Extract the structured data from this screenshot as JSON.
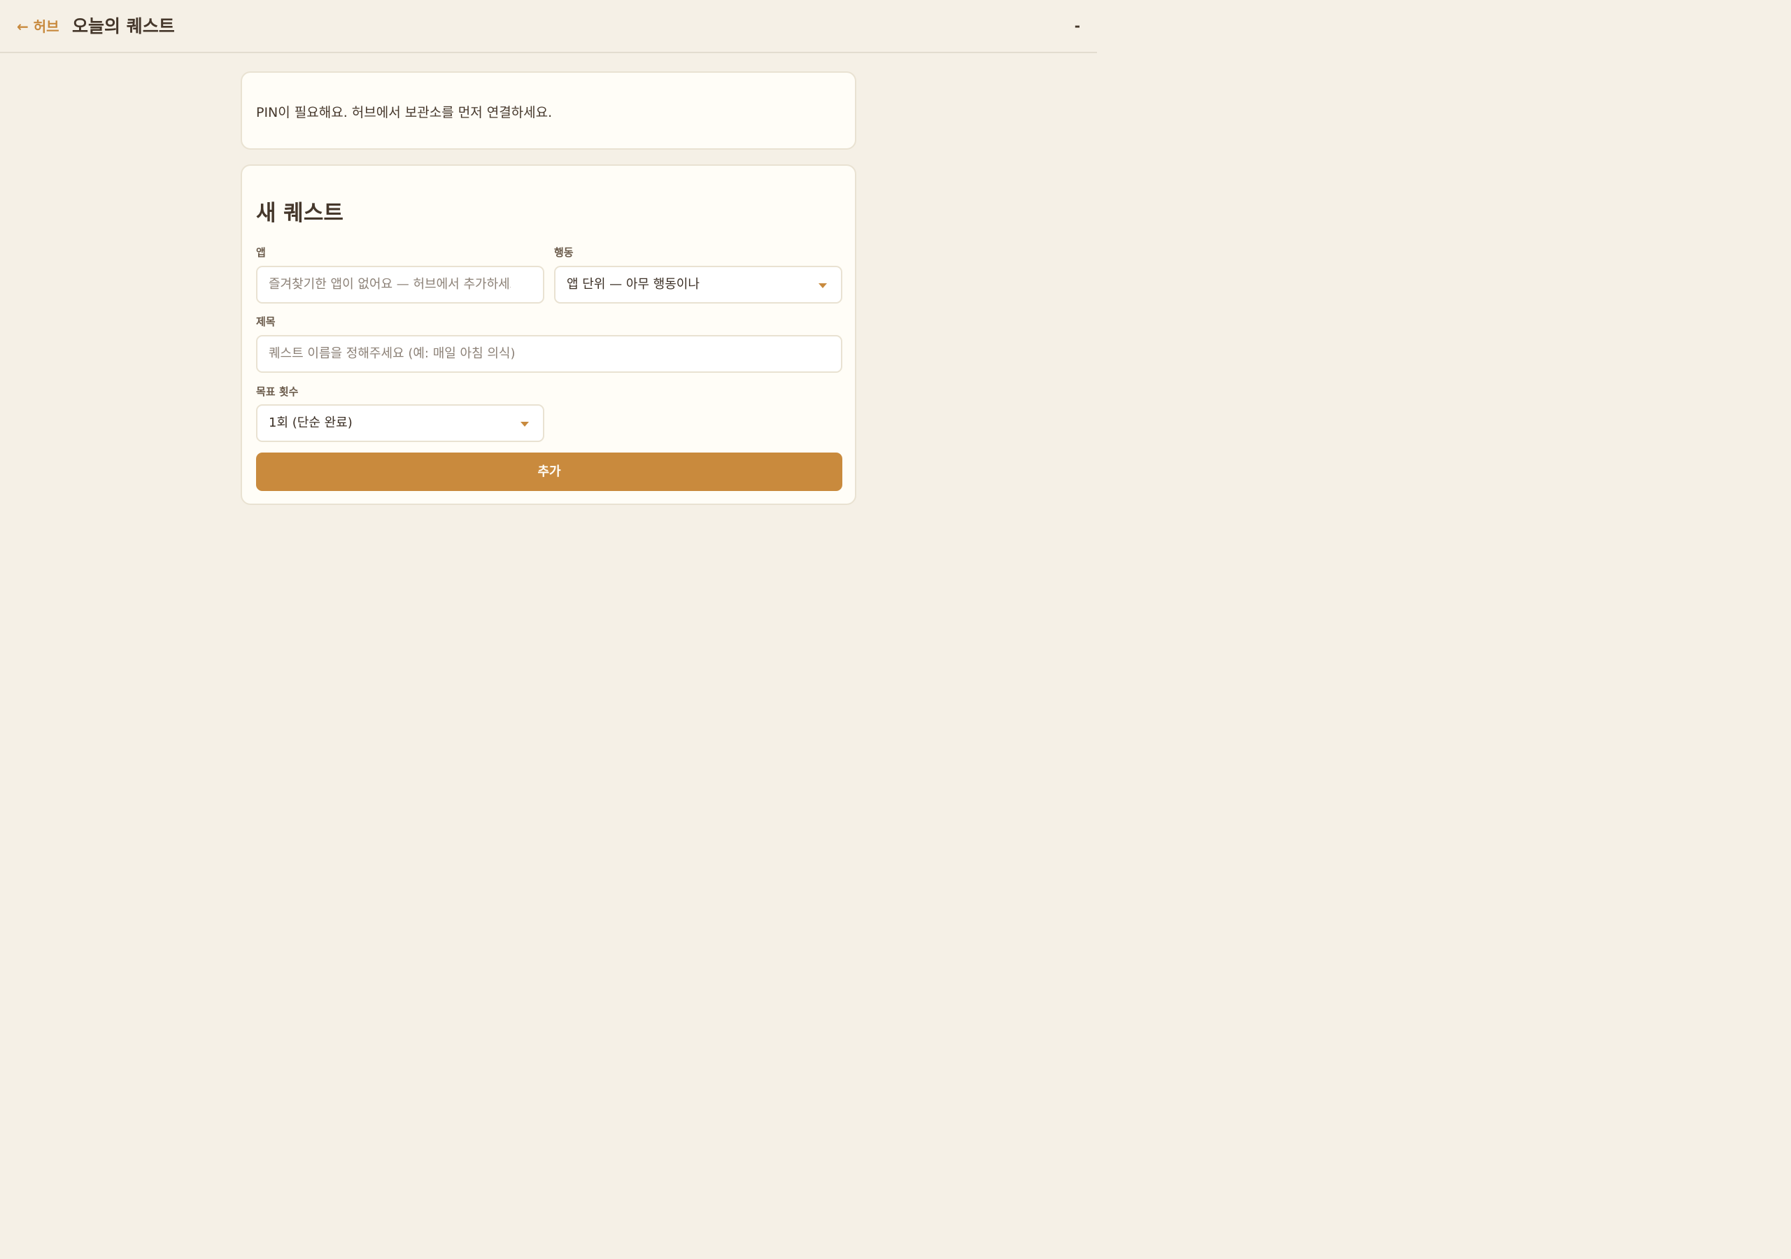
{
  "header": {
    "back_label": "← 허브",
    "title": "오늘의 퀘스트",
    "right_indicator": "-"
  },
  "notice": {
    "text": "PIN이 필요해요. 허브에서 보관소를 먼저 연결하세요."
  },
  "form": {
    "title": "새 퀘스트",
    "app": {
      "label": "앱",
      "placeholder": "즐겨찾기한 앱이 없어요 — 허브에서 추가하세요"
    },
    "action": {
      "label": "행동",
      "selected": "앱 단위 — 아무 행동이나"
    },
    "name": {
      "label": "제목",
      "placeholder": "퀘스트 이름을 정해주세요 (예: 매일 아침 의식)"
    },
    "target_count": {
      "label": "목표 횟수",
      "selected": "1회 (단순 완료)"
    },
    "submit_label": "추가"
  },
  "colors": {
    "accent": "#c98a3d",
    "background": "#f5f0e6",
    "card": "#fffdf7",
    "border": "#e9e2d2",
    "text": "#45372b"
  }
}
